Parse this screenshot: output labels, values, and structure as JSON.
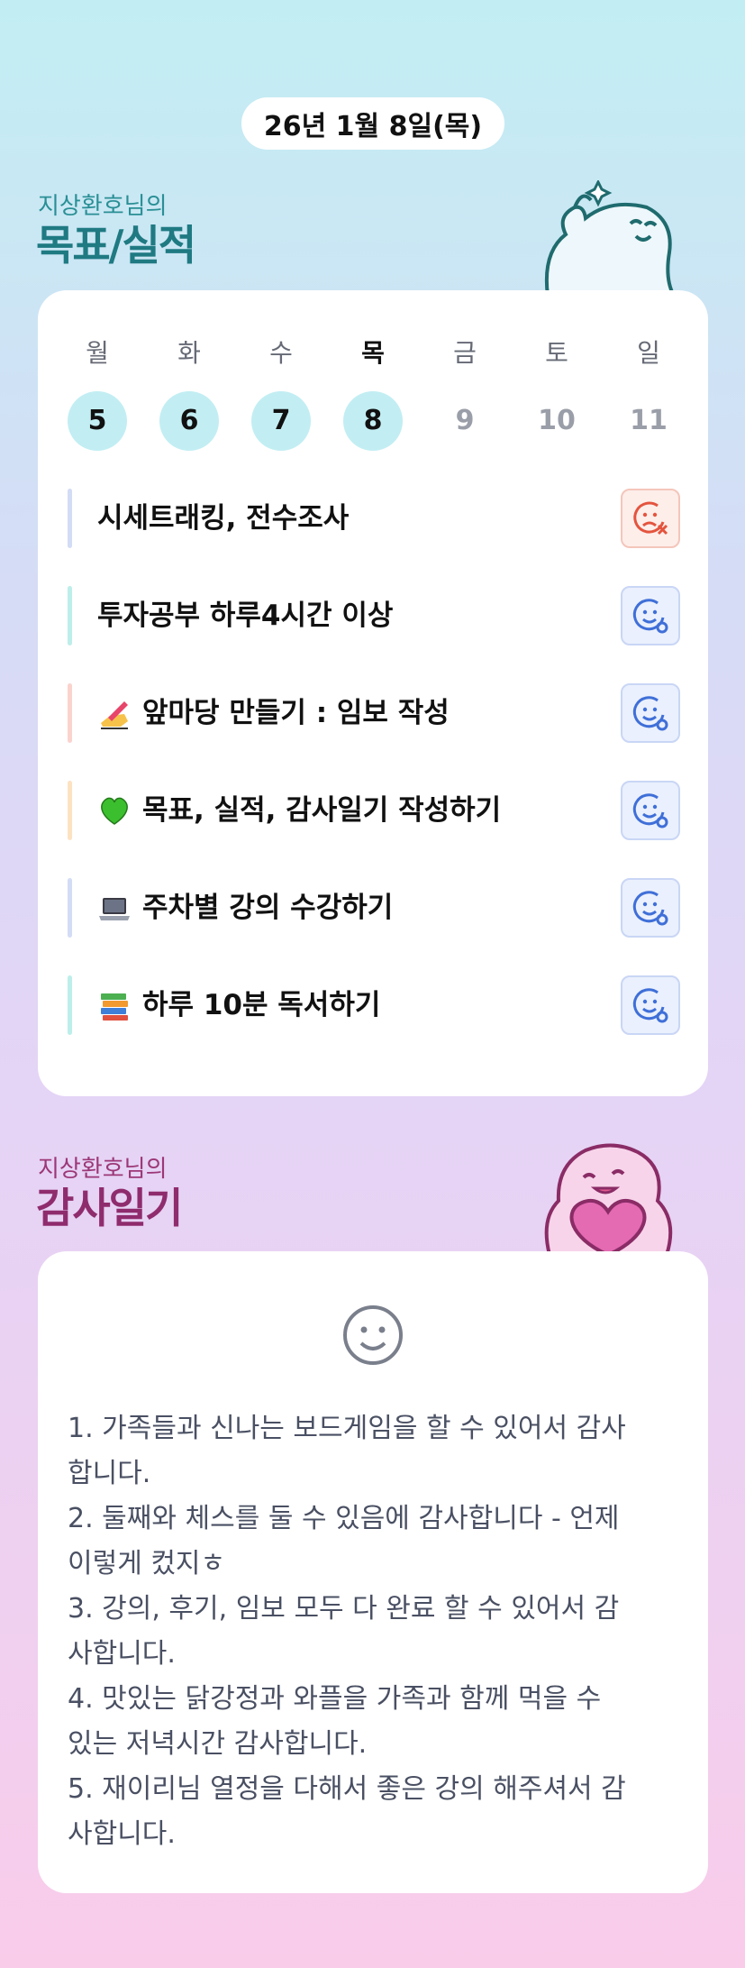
{
  "header": {
    "date": "26년 1월 8일(목)"
  },
  "goals_section": {
    "subtitle": "지상환호님의",
    "title": "목표/실적"
  },
  "week": [
    {
      "name": "월",
      "date": "5",
      "done": true,
      "today": false
    },
    {
      "name": "화",
      "date": "6",
      "done": true,
      "today": false
    },
    {
      "name": "수",
      "date": "7",
      "done": true,
      "today": false
    },
    {
      "name": "목",
      "date": "8",
      "done": true,
      "today": true
    },
    {
      "name": "금",
      "date": "9",
      "done": false,
      "today": false
    },
    {
      "name": "토",
      "date": "10",
      "done": false,
      "today": false
    },
    {
      "name": "일",
      "date": "11",
      "done": false,
      "today": false
    }
  ],
  "goals": [
    {
      "text": "시세트래킹, 전수조사",
      "emoji": "",
      "status": "fail-face-icon",
      "bar_color": "#d3dcf5"
    },
    {
      "text": "투자공부 하루4시간 이상",
      "emoji": "",
      "status": "success-face-icon",
      "bar_color": "#bdeeea"
    },
    {
      "text": "앞마당 만들기 : 임보 작성",
      "emoji": "writing-hand-icon",
      "status": "success-face-icon",
      "bar_color": "#fbd3ce"
    },
    {
      "text": "목표, 실적, 감사일기 작성하기",
      "emoji": "green-heart-icon",
      "status": "success-face-icon",
      "bar_color": "#fde2c2"
    },
    {
      "text": "주차별 강의 수강하기",
      "emoji": "laptop-icon",
      "status": "success-face-icon",
      "bar_color": "#d3dcf5"
    },
    {
      "text": "하루 10분 독서하기",
      "emoji": "books-icon",
      "status": "success-face-icon",
      "bar_color": "#bdeeea"
    }
  ],
  "gratitude_section": {
    "subtitle": "지상환호님의",
    "title": "감사일기"
  },
  "gratitude": {
    "mood_icon": "smile-face-icon",
    "text": "1. 가족들과 신나는 보드게임을 할 수 있어서 감사\n합니다.\n2. 둘째와 체스를 둘 수 있음에 감사합니다 - 언제\n이렇게 컸지ㅎ\n3. 강의, 후기, 임보 모두 다 완료 할 수 있어서 감\n사합니다.\n4. 맛있는 닭강정과 와플을 가족과 함께 먹을 수\n있는 저녁시간 감사합니다.\n5. 재이리님 열정을 다해서 좋은 강의 해주셔서 감\n사합니다."
  },
  "colors": {
    "goals_title": "#1f7a82",
    "gratitude_title": "#8f2c6d",
    "done_day": "#c2eef3",
    "fail": "#e4543e",
    "ok": "#3f6fd8"
  }
}
